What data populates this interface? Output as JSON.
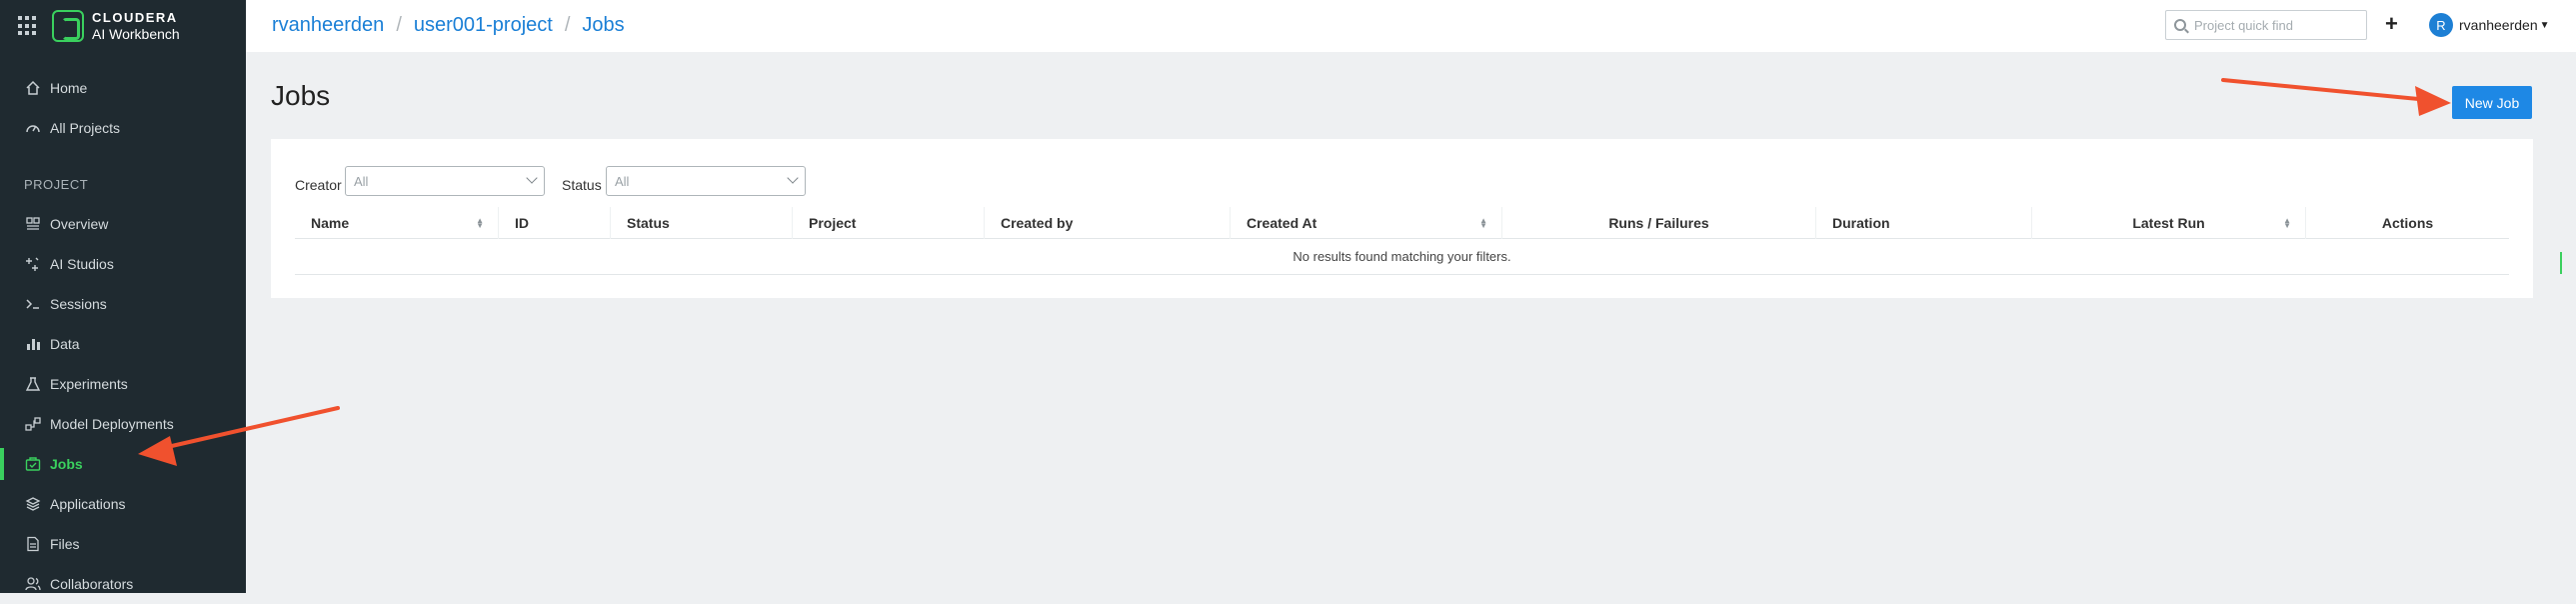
{
  "brand": {
    "name": "CLOUDERA",
    "subtitle": "AI Workbench"
  },
  "sidebar": {
    "top_items": [
      {
        "label": "Home",
        "icon": "home-icon"
      },
      {
        "label": "All Projects",
        "icon": "dashboard-icon"
      }
    ],
    "section_label": "PROJECT",
    "project_items": [
      {
        "label": "Overview",
        "icon": "overview-icon"
      },
      {
        "label": "AI Studios",
        "icon": "ai-studios-icon"
      },
      {
        "label": "Sessions",
        "icon": "terminal-icon"
      },
      {
        "label": "Data",
        "icon": "bar-chart-icon"
      },
      {
        "label": "Experiments",
        "icon": "flask-icon"
      },
      {
        "label": "Model Deployments",
        "icon": "model-deploy-icon"
      },
      {
        "label": "Jobs",
        "icon": "jobs-icon",
        "active": true
      },
      {
        "label": "Applications",
        "icon": "layers-icon"
      },
      {
        "label": "Files",
        "icon": "file-icon"
      },
      {
        "label": "Collaborators",
        "icon": "users-icon"
      }
    ],
    "active_color": "#3ad05e"
  },
  "header": {
    "breadcrumb": [
      "rvanheerden",
      "user001-project",
      "Jobs"
    ],
    "search_placeholder": "Project quick find",
    "add_label": "+",
    "user": {
      "initial": "R",
      "name": "rvanheerden"
    }
  },
  "main": {
    "title": "Jobs",
    "new_job_label": "New Job",
    "filters": {
      "creator_label": "Creator",
      "creator_value": "All",
      "status_label": "Status",
      "status_value": "All"
    },
    "table": {
      "columns": [
        "Name",
        "ID",
        "Status",
        "Project",
        "Created by",
        "Created At",
        "Runs / Failures",
        "Duration",
        "Latest Run",
        "Actions"
      ],
      "empty_message": "No results found matching your filters."
    }
  },
  "colors": {
    "accent": "#1e88e5",
    "annotation_arrow": "#f0512e",
    "sidebar_bg": "#1f2a30"
  }
}
